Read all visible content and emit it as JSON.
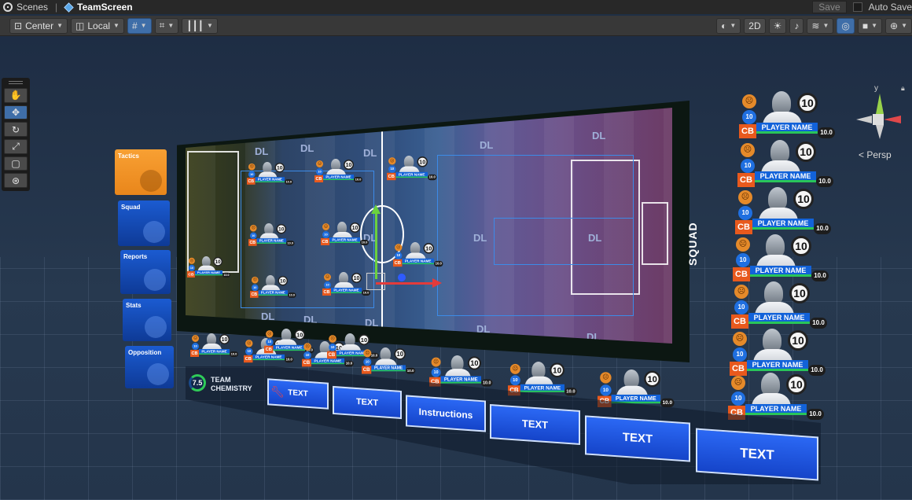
{
  "topbar": {
    "breadcrumb_root": "Scenes",
    "breadcrumb_current": "TeamScreen",
    "save": "Save",
    "auto_save": "Auto Save"
  },
  "toolbar": {
    "pivot": "Center",
    "space": "Local",
    "view_2d": "2D"
  },
  "scene": {
    "persp": "Persp",
    "gizmo_y": "y"
  },
  "side_tabs": [
    {
      "label": "Tactics",
      "color": "#f08e25"
    },
    {
      "label": "Squad",
      "color": "#1750c0"
    },
    {
      "label": "Reports",
      "color": "#1750c0"
    },
    {
      "label": "Stats",
      "color": "#1750c0"
    },
    {
      "label": "Opposition",
      "color": "#1750c0"
    }
  ],
  "zone_label": "DL",
  "player_card": {
    "position": "CB",
    "number": "10",
    "rating": "10",
    "name": "PLAYER NAME",
    "score": "10.0"
  },
  "squad_label": "SQUAD",
  "team_chemistry": {
    "value": "7.5",
    "label_line1": "TEAM",
    "label_line2": "CHEMISTRY"
  },
  "bottom_buttons": [
    "TEXT",
    "TEXT",
    "Instructions",
    "TEXT",
    "TEXT",
    "TEXT"
  ]
}
